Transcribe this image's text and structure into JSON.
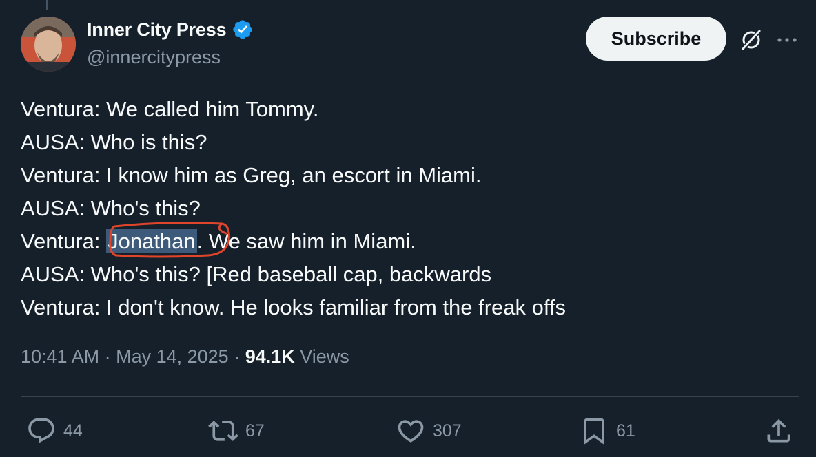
{
  "author": {
    "display_name": "Inner City Press",
    "handle": "@innercitypress"
  },
  "header": {
    "subscribe_label": "Subscribe"
  },
  "tweet": {
    "lines": [
      "Ventura: We called him Tommy.",
      "AUSA: Who is this?",
      "Ventura: I know him as Greg, an escort in Miami.",
      "AUSA: Who's this?",
      "Ventura: ",
      "AUSA: Who's this? [Red baseball cap, backwards",
      "Ventura: I don't know. He looks familiar from the freak offs"
    ],
    "highlighted_word": "Jonathan",
    "line5_rest": ". We saw him in Miami."
  },
  "meta": {
    "time": "10:41 AM",
    "sep1": " · ",
    "date": "May 14, 2025",
    "sep2": " · ",
    "views_count": "94.1K",
    "views_label": " Views"
  },
  "actions": {
    "replies": "44",
    "reposts": "67",
    "likes": "307",
    "bookmarks": "61"
  },
  "colors": {
    "background": "#15202b",
    "text": "#f7f9f9",
    "muted": "#8b98a5",
    "verified": "#1d9bf0",
    "highlight": "#3d5a7a",
    "annotation": "#e0442b"
  },
  "icons": [
    "verified-badge-icon",
    "grok-icon",
    "more-icon",
    "reply-icon",
    "repost-icon",
    "like-icon",
    "bookmark-icon",
    "share-icon"
  ]
}
